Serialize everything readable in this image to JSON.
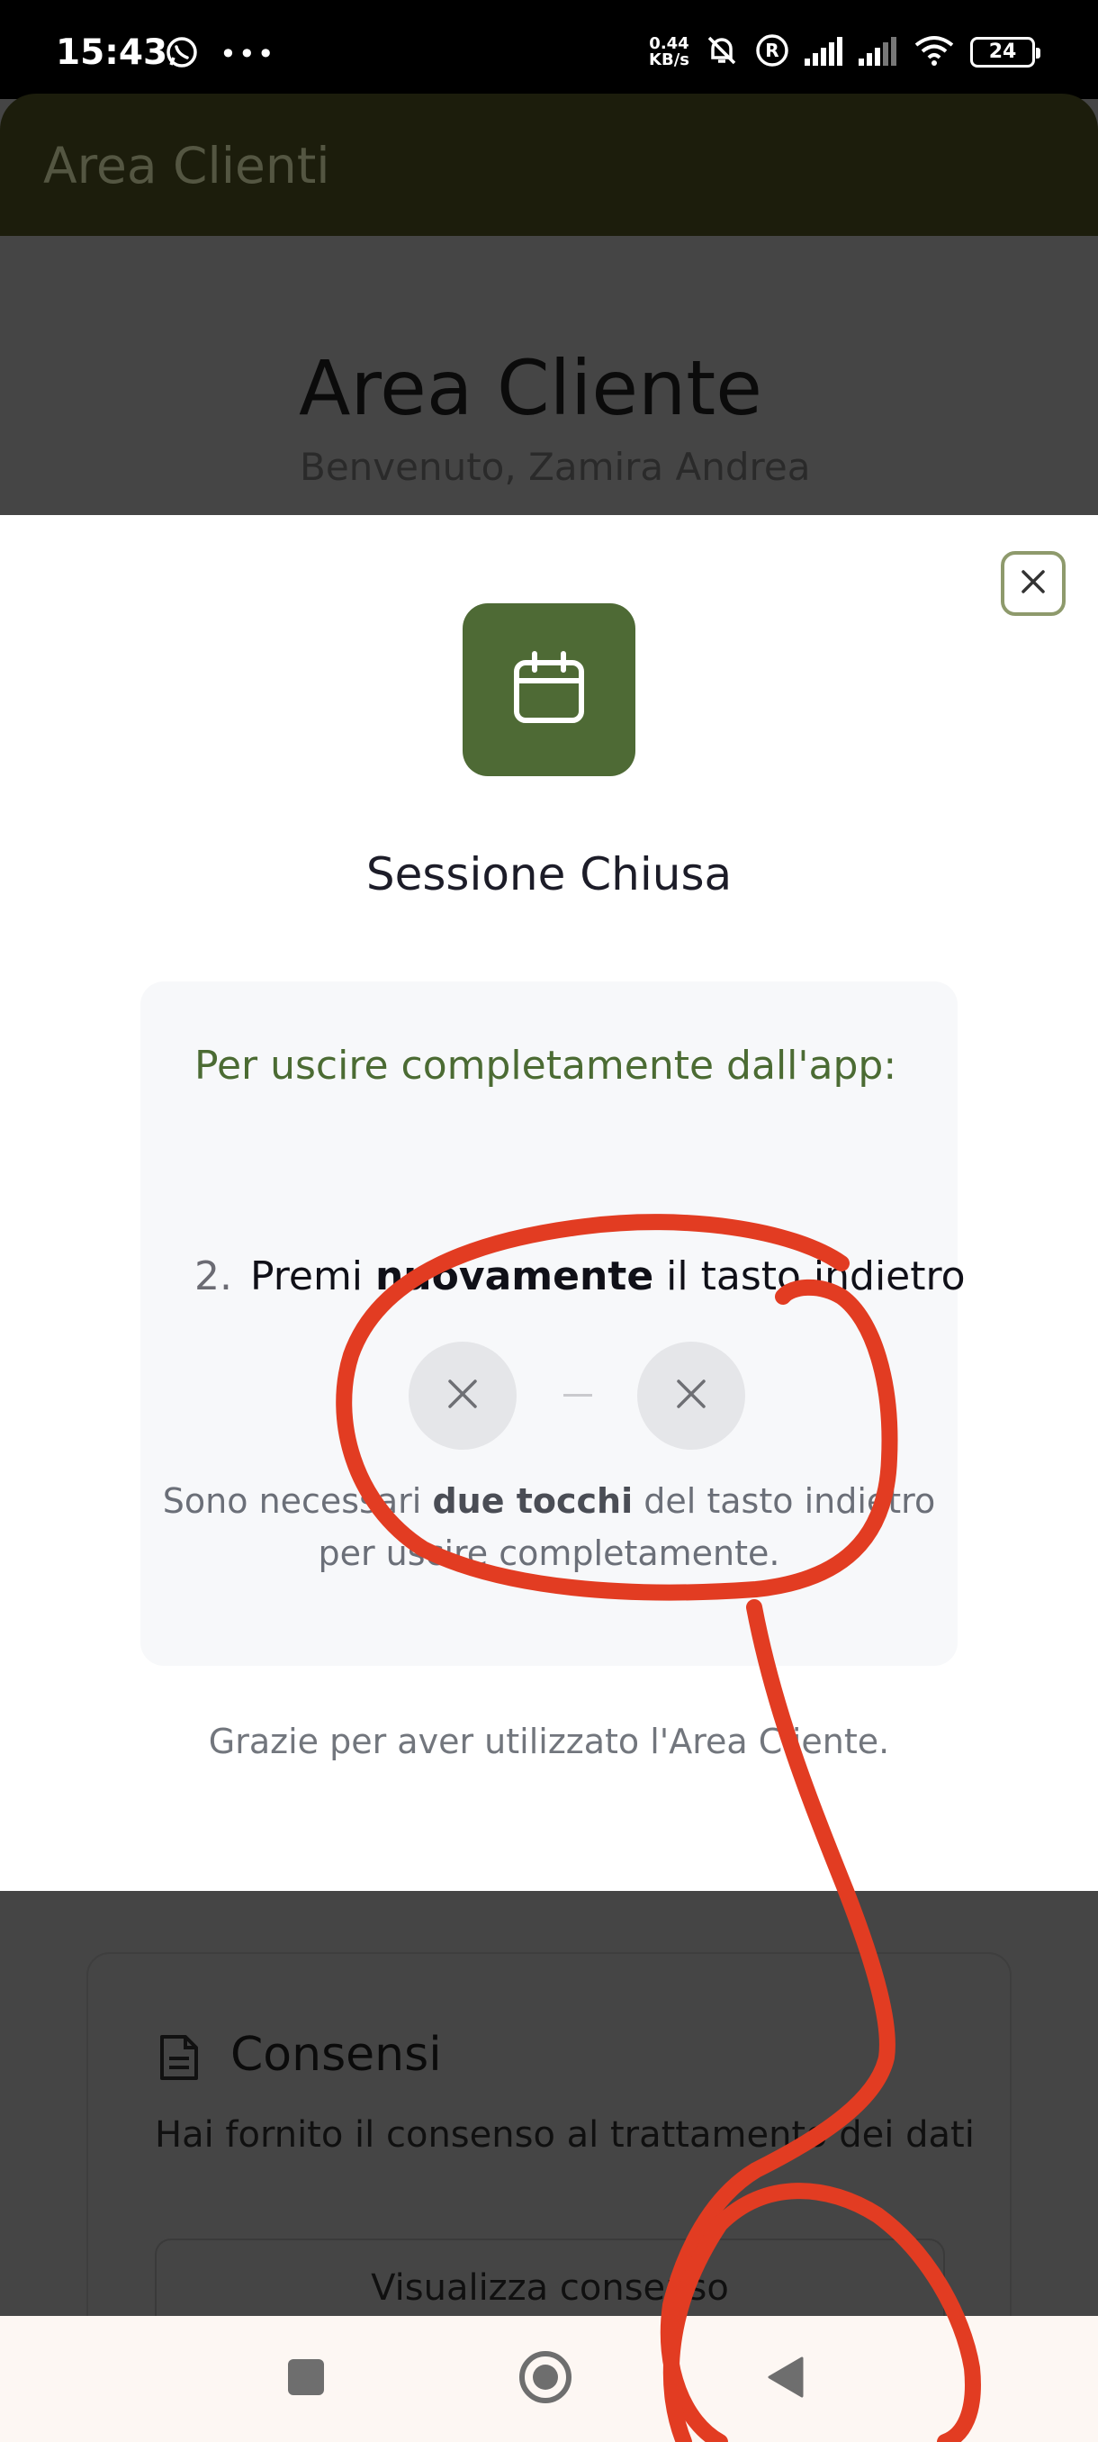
{
  "status_bar": {
    "time": "15:43",
    "net_speed_value": "0.44",
    "net_speed_unit": "KB/s",
    "battery": "24",
    "icons": [
      "whatsapp-icon",
      "more-dots-icon",
      "bell-off-icon",
      "registered-icon",
      "signal-icon",
      "signal-icon",
      "wifi-icon",
      "battery-icon"
    ]
  },
  "app_header": {
    "title": "Area Clienti"
  },
  "background": {
    "title": "Area Cliente",
    "subtitle": "Benvenuto, Zamira Andrea",
    "card": {
      "title": "Consensi",
      "text": "Hai fornito il consenso al trattamento dei dati",
      "button_label": "Visualizza consenso"
    }
  },
  "sheet": {
    "title": "Sessione Chiusa",
    "info_heading": "Per uscire completamente dall'app:",
    "step": {
      "number": "2.",
      "prefix": "Premi",
      "emphasis": "nuovamente",
      "suffix": "il tasto indietro"
    },
    "note": {
      "prefix": "Sono necessari",
      "emphasis": "due tocchi",
      "suffix": "del tasto indietro per uscire completamente."
    },
    "thanks": "Grazie per aver utilizzato l'Area Cliente."
  },
  "colors": {
    "accent_green": "#4e6a35",
    "heading_green": "#4b6b33",
    "annotation_red": "#e23c22"
  }
}
